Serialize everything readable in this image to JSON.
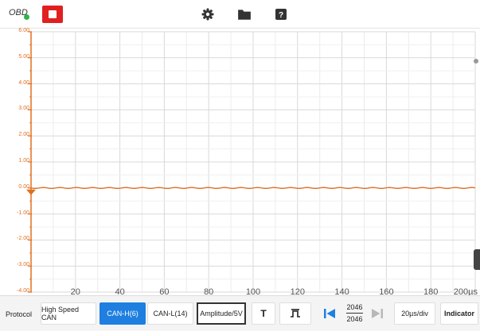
{
  "topbar": {
    "obd_label": "OBD",
    "obd_status_color": "#2fb44a",
    "stop_color": "#e0201f",
    "icons": [
      "stop-icon",
      "gear-icon",
      "folder-icon",
      "help-icon"
    ]
  },
  "chart_data": {
    "type": "line",
    "y_ticks": [
      "6.00",
      "5.00",
      "4.00",
      "3.00",
      "2.00",
      "1.00",
      "0.00",
      "-1.00",
      "-2.00",
      "-3.00",
      "-4.00"
    ],
    "x_ticks": [
      "20",
      "40",
      "60",
      "80",
      "100",
      "120",
      "140",
      "160",
      "180",
      "200µs"
    ],
    "xlim": [
      0,
      200
    ],
    "ylim": [
      -4,
      6
    ],
    "grid": true,
    "series": [
      {
        "color": "#e07020",
        "x": [
          0,
          20,
          40,
          60,
          80,
          100,
          120,
          140,
          160,
          180,
          200
        ],
        "y": [
          0,
          0,
          0,
          0,
          0,
          0,
          0,
          0,
          0,
          0,
          0
        ]
      }
    ]
  },
  "bottombar": {
    "protocol_label": "Protocol",
    "protocol_value": "High Speed CAN",
    "channel_high": "CAN-H(6)",
    "channel_low": "CAN-L(14)",
    "amplitude": "Amplitude/5V",
    "trigger_label": "T",
    "page_current": "2046",
    "page_total": "2046",
    "timebase": "20µs/div",
    "indicator": "Indicator",
    "accent_color": "#1e7fe0"
  }
}
